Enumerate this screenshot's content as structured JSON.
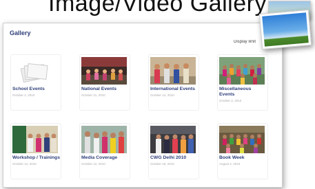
{
  "heading": {
    "title": "Image/Video Gallery"
  },
  "gallery": {
    "title": "Gallery",
    "display_link": "Display limit",
    "items": [
      {
        "title": "School Events",
        "date": "October 2, 2010",
        "thumb_icon": "placeholder-stack-icon"
      },
      {
        "title": "National Events",
        "date": "October 21, 2010",
        "thumb_icon": "stage-performance-photo"
      },
      {
        "title": "International Events",
        "date": "October 14, 2010",
        "thumb_icon": "group-photo"
      },
      {
        "title": "Miscellaneous Events",
        "date": "October 2, 2010",
        "thumb_icon": "group-photo"
      },
      {
        "title": "Workshop / Trainings",
        "date": "October 12, 2010",
        "thumb_icon": "group-photo"
      },
      {
        "title": "Media Coverage",
        "date": "October 12, 2010",
        "thumb_icon": "group-photo"
      },
      {
        "title": "CWG Delhi 2010",
        "date": "October 18, 2010",
        "thumb_icon": "group-photo"
      },
      {
        "title": "Book Week",
        "date": "August 2, 2010",
        "thumb_icon": "group-photo"
      }
    ]
  },
  "colors": {
    "title": "#2e3e7a",
    "date": "#aaaaaa"
  }
}
